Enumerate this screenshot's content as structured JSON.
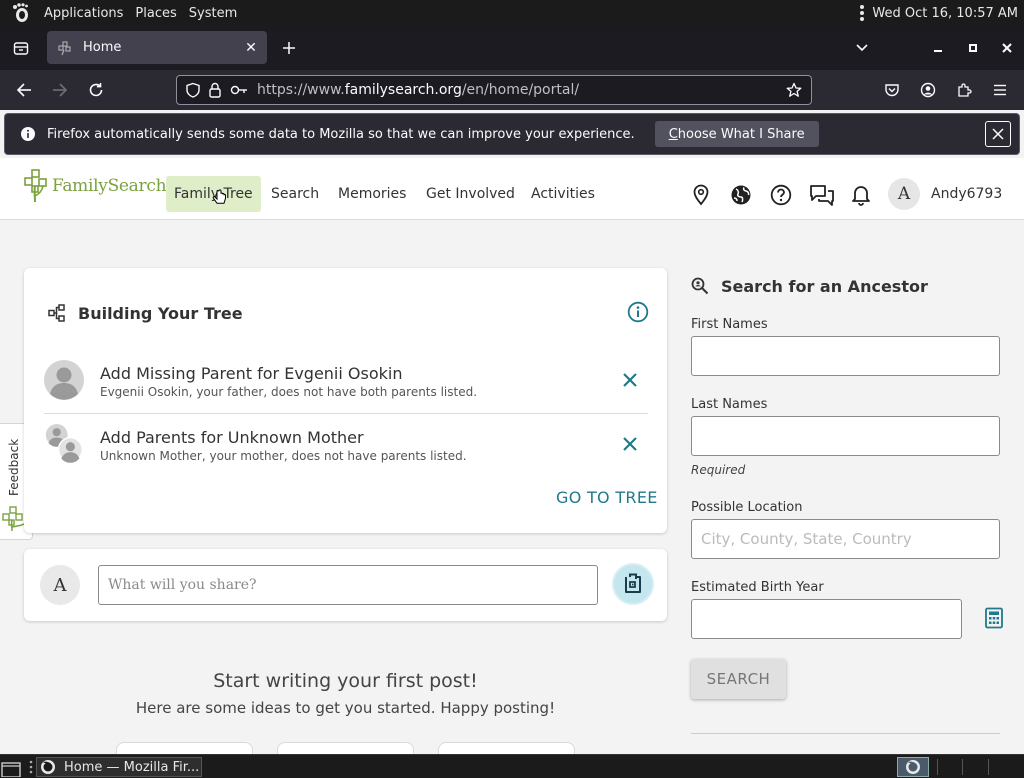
{
  "system_panel": {
    "applications": "Applications",
    "places": "Places",
    "system": "System",
    "clock": "Wed Oct 16, 10:57 AM"
  },
  "browser": {
    "tab_title": "Home",
    "url_prefix": "https://www.",
    "url_host": "familysearch.org",
    "url_path": "/en/home/portal/",
    "notification": {
      "message": "Firefox automatically sends some data to Mozilla so that we can improve your experience.",
      "choose_underlined": "C",
      "choose_rest": "hoose What I Share"
    }
  },
  "site": {
    "logo_text": "FamilySearch",
    "nav": [
      "Family Tree",
      "Search",
      "Memories",
      "Get Involved",
      "Activities"
    ],
    "avatar_initial": "A",
    "username": "Andy6793",
    "feedback_label": "Feedback",
    "accent_color": "#7aa23e"
  },
  "tree_card": {
    "title": "Building Your Tree",
    "tasks": [
      {
        "title": "Add Missing Parent for Evgenii Osokin",
        "subtitle": "Evgenii Osokin, your father, does not have both parents listed."
      },
      {
        "title": "Add Parents for Unknown Mother",
        "subtitle": "Unknown Mother, your mother, does not have parents listed."
      }
    ],
    "go_to_tree": "GO TO TREE"
  },
  "post": {
    "avatar_initial": "A",
    "placeholder": "What will you share?"
  },
  "feed": {
    "heading": "Start writing your first post!",
    "subheading": "Here are some ideas to get you started. Happy posting!"
  },
  "ancestor_search": {
    "title": "Search for an Ancestor",
    "first_names_label": "First Names",
    "last_names_label": "Last Names",
    "required_note": "Required",
    "location_label": "Possible Location",
    "location_placeholder": "City, County, State, Country",
    "birth_year_label": "Estimated Birth Year",
    "search_button": "SEARCH"
  },
  "taskbar": {
    "window_title": "Home — Mozilla Fir..."
  }
}
